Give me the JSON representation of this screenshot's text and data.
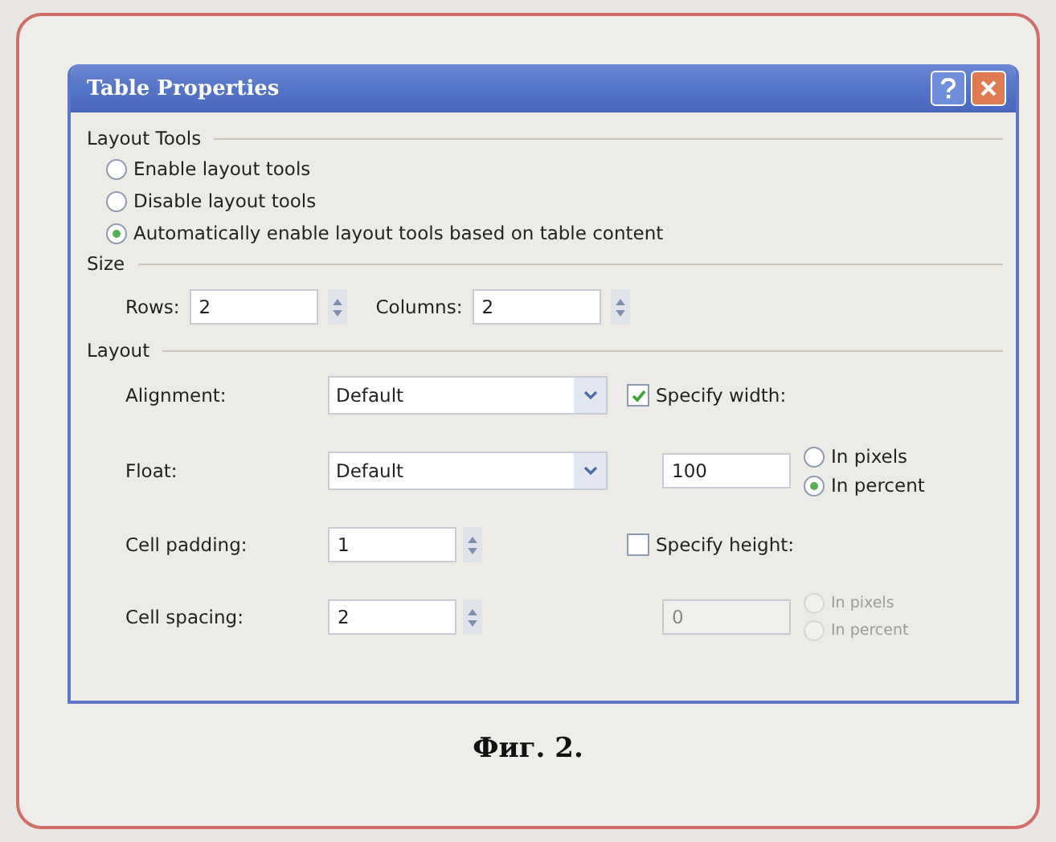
{
  "window": {
    "title": "Table Properties"
  },
  "layout_tools": {
    "heading": "Layout Tools",
    "options": [
      {
        "label": "Enable layout tools",
        "selected": false
      },
      {
        "label": "Disable layout tools",
        "selected": false
      },
      {
        "label": "Automatically enable layout tools based on table content",
        "selected": true
      }
    ]
  },
  "size": {
    "heading": "Size",
    "rows": {
      "label": "Rows:",
      "value": "2"
    },
    "columns": {
      "label": "Columns:",
      "value": "2"
    }
  },
  "layout": {
    "heading": "Layout",
    "alignment": {
      "label": "Alignment:",
      "value": "Default"
    },
    "float": {
      "label": "Float:",
      "value": "Default"
    },
    "cell_padding": {
      "label": "Cell padding:",
      "value": "1"
    },
    "cell_spacing": {
      "label": "Cell spacing:",
      "value": "2"
    },
    "specify_width": {
      "label": "Specify width:",
      "checked": true,
      "value": "100",
      "units": [
        {
          "label": "In pixels",
          "selected": false
        },
        {
          "label": "In percent",
          "selected": true
        }
      ]
    },
    "specify_height": {
      "label": "Specify height:",
      "checked": false,
      "value": "0",
      "units": [
        {
          "label": "In pixels",
          "selected": false
        },
        {
          "label": "In percent",
          "selected": false
        }
      ]
    }
  },
  "caption": "Фиг. 2."
}
